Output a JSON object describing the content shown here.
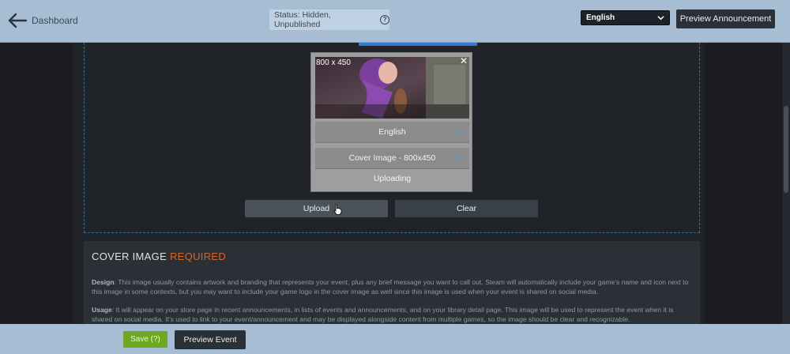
{
  "header": {
    "back_label": "Dashboard",
    "status_text": "Status: Hidden, Unpublished",
    "status_help": "?",
    "language_selected": "English",
    "preview_announcement": "Preview Announcement"
  },
  "modal": {
    "dimensions_label": "800 x 450",
    "close_symbol": "✕",
    "language_value": "English",
    "image_type_value": "Cover Image - 800x450",
    "status": "Uploading"
  },
  "actions": {
    "upload_label": "Upload",
    "clear_label": "Clear"
  },
  "cover_info": {
    "title": "COVER IMAGE",
    "required": "REQUIRED",
    "design_label": "Design",
    "design_text": ": This image usually contains artwork and branding that represents your event, plus any brief message you want to call out. Steam will automatically include your game's name and icon next to this image in some contexts, but you may want to include your game logo in the cover image as well since this image is used when your event is shared on social media.",
    "usage_label": "Usage",
    "usage_text": ": It will appear on your store page in recent announcements, in lists of events and announcements, and on your library detail page. This image will be used to represent the event when it is shared on social media. It's used to link to your event/announcement and may be displayed alongside content from multiple games, so the image should be clear and recognizable."
  },
  "footer": {
    "save_label": "Save (?)",
    "preview_event_label": "Preview Event"
  },
  "colors": {
    "header_bg": "#a7bdd3",
    "accent_blue": "#2f7bd1",
    "required_orange": "#d4642a",
    "save_green": "#6fa720"
  },
  "icons": {
    "back": "arrow-left-icon",
    "help": "question-circle-icon",
    "dropdown": "chevron-down-icon",
    "close": "close-icon",
    "cursor": "hand-cursor-icon"
  }
}
